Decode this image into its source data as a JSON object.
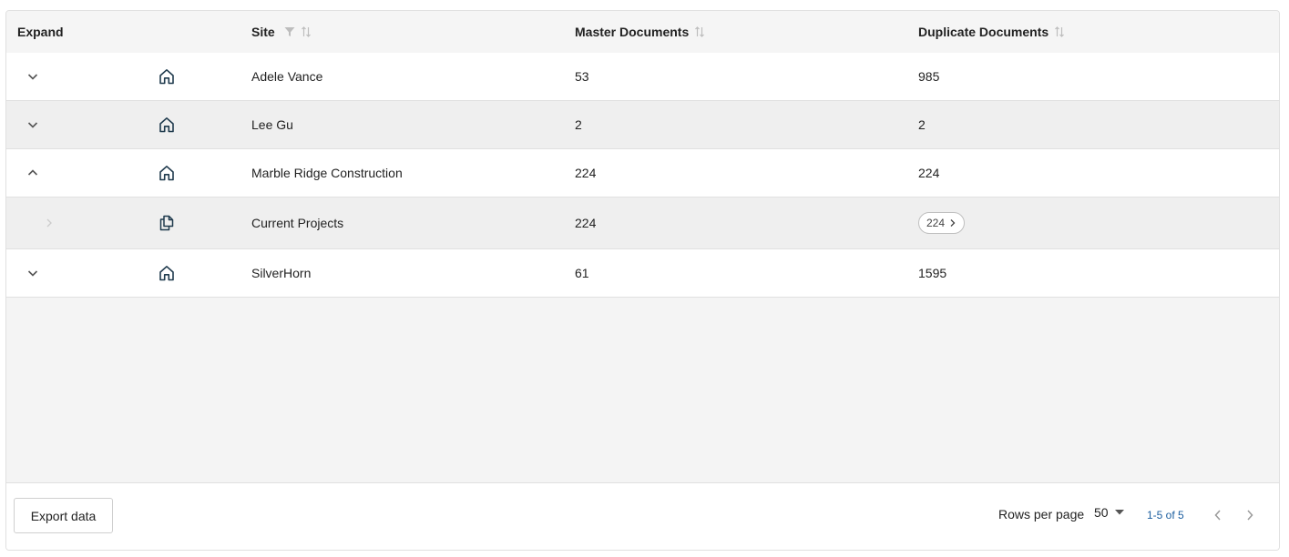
{
  "header": {
    "expand": "Expand",
    "site": "Site",
    "master": "Master Documents",
    "duplicate": "Duplicate Documents"
  },
  "rows": [
    {
      "site": "Adele Vance",
      "master": "53",
      "duplicate": "985",
      "icon": "home-icon",
      "chevron": "chevron-down-icon"
    },
    {
      "site": "Lee Gu",
      "master": "2",
      "duplicate": "2",
      "icon": "home-icon",
      "chevron": "chevron-down-icon"
    },
    {
      "site": "Marble Ridge Construction",
      "master": "224",
      "duplicate": "224",
      "icon": "home-icon",
      "chevron": "chevron-up-icon"
    },
    {
      "site": "Current Projects",
      "master": "224",
      "duplicate": "224",
      "icon": "documents-icon",
      "chevron": "chevron-right-icon"
    },
    {
      "site": "SilverHorn",
      "master": "61",
      "duplicate": "1595",
      "icon": "home-icon",
      "chevron": "chevron-down-icon"
    }
  ],
  "footer": {
    "export_label": "Export data",
    "rows_per_page_label": "Rows per page",
    "rows_per_page_value": "50",
    "range_label": "1-5 of 5"
  },
  "colors": {
    "header_bg": "#f5f5f5",
    "row_alt_bg": "#efefef",
    "empty_bg": "#f4f4f4",
    "icon_color": "#1f3a4d",
    "link_color": "#1d5fa0"
  }
}
